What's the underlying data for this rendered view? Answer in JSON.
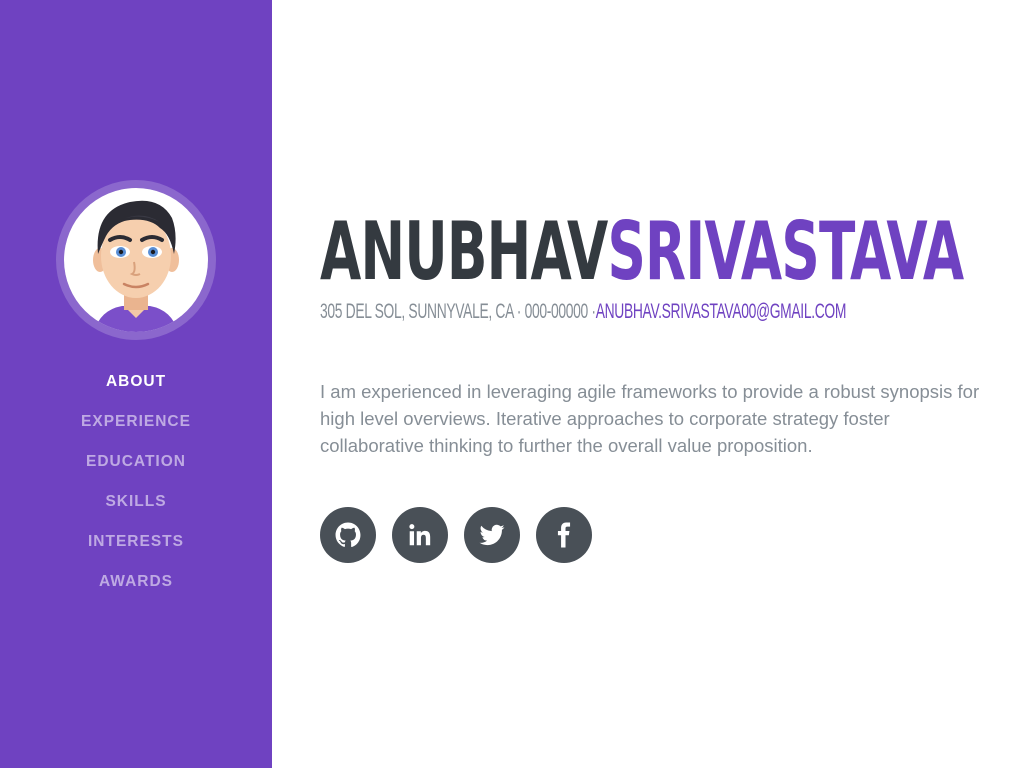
{
  "sidebar": {
    "background": "#6f42c1",
    "avatar_icon": "avatar-cartoon-face",
    "nav": [
      {
        "label": "About",
        "active": true
      },
      {
        "label": "Experience"
      },
      {
        "label": "Education"
      },
      {
        "label": "Skills"
      },
      {
        "label": "Interests"
      },
      {
        "label": "Awards"
      }
    ]
  },
  "profile": {
    "first_name": "Anubhav",
    "last_name": "Srivastava",
    "address": "305 Del Sol, Sunnyvale, CA · 000-00000 ·",
    "email": "anubhav.srivastava00@gmail.com",
    "bio": "I am experienced in leveraging agile frameworks to provide a robust synopsis for high level overviews. Iterative approaches to corporate strategy foster collaborative thinking to further the overall value proposition."
  },
  "social": [
    {
      "icon": "github-icon"
    },
    {
      "icon": "linkedin-icon"
    },
    {
      "icon": "twitter-icon"
    },
    {
      "icon": "facebook-icon"
    }
  ],
  "colors": {
    "primary": "#6f42c1",
    "heading": "#343a40",
    "muted": "#868e96",
    "social_bg": "#495057"
  }
}
